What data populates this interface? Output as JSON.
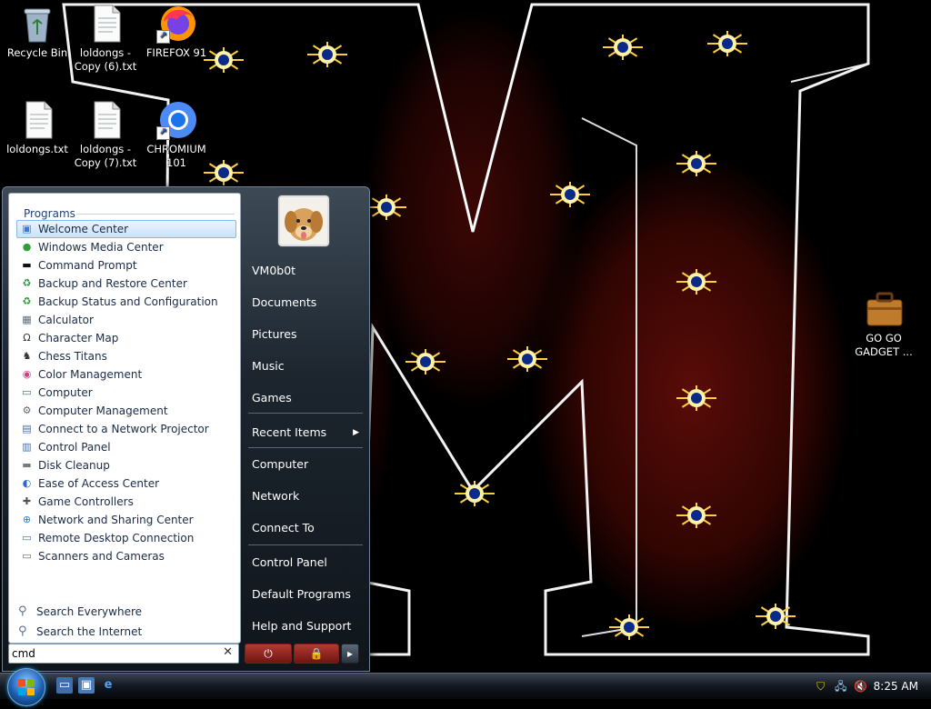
{
  "desktop": {
    "icons": [
      {
        "label": "Recycle Bin",
        "icon": "recycle-bin-icon"
      },
      {
        "label": "loldongs - Copy (6).txt",
        "icon": "text-file-icon"
      },
      {
        "label": "FIREFOX 91",
        "icon": "firefox-icon"
      },
      {
        "label": "loldongs.txt",
        "icon": "text-file-icon"
      },
      {
        "label": "loldongs - Copy (7).txt",
        "icon": "text-file-icon"
      },
      {
        "label": "CHROMIUM 101",
        "icon": "chromium-icon"
      },
      {
        "label": "GO GO GADGET ...",
        "icon": "briefcase-icon"
      }
    ]
  },
  "start_menu": {
    "programs_header": "Programs",
    "programs": [
      {
        "label": "Welcome Center",
        "icon": "welcome-center-icon",
        "selected": true
      },
      {
        "label": "Windows Media Center",
        "icon": "media-center-icon"
      },
      {
        "label": "Command Prompt",
        "icon": "command-prompt-icon"
      },
      {
        "label": "Backup and Restore Center",
        "icon": "backup-icon"
      },
      {
        "label": "Backup Status and Configuration",
        "icon": "backup-status-icon"
      },
      {
        "label": "Calculator",
        "icon": "calculator-icon"
      },
      {
        "label": "Character Map",
        "icon": "character-map-icon"
      },
      {
        "label": "Chess Titans",
        "icon": "chess-icon"
      },
      {
        "label": "Color Management",
        "icon": "color-management-icon"
      },
      {
        "label": "Computer",
        "icon": "computer-icon"
      },
      {
        "label": "Computer Management",
        "icon": "computer-management-icon"
      },
      {
        "label": "Connect to a Network Projector",
        "icon": "network-projector-icon"
      },
      {
        "label": "Control Panel",
        "icon": "control-panel-icon"
      },
      {
        "label": "Disk Cleanup",
        "icon": "disk-cleanup-icon"
      },
      {
        "label": "Ease of Access Center",
        "icon": "ease-of-access-icon"
      },
      {
        "label": "Game Controllers",
        "icon": "game-controller-icon"
      },
      {
        "label": "Network and Sharing Center",
        "icon": "network-sharing-icon"
      },
      {
        "label": "Remote Desktop Connection",
        "icon": "remote-desktop-icon"
      },
      {
        "label": "Scanners and Cameras",
        "icon": "scanner-icon"
      }
    ],
    "search_links": [
      {
        "label": "Search Everywhere"
      },
      {
        "label": "Search the Internet"
      }
    ],
    "search_value": "cmd",
    "user_name": "VM0b0t",
    "right_items": {
      "documents": "Documents",
      "pictures": "Pictures",
      "music": "Music",
      "games": "Games",
      "recent_items": "Recent Items",
      "computer": "Computer",
      "network": "Network",
      "connect_to": "Connect To",
      "control_panel": "Control Panel",
      "default_programs": "Default Programs",
      "help_and_support": "Help and Support"
    }
  },
  "taskbar": {
    "clock": "8:25 AM"
  },
  "colors": {
    "selection": "#c9e3f8",
    "power_button": "#a32d27",
    "start_orb": "#1c5fb3"
  }
}
